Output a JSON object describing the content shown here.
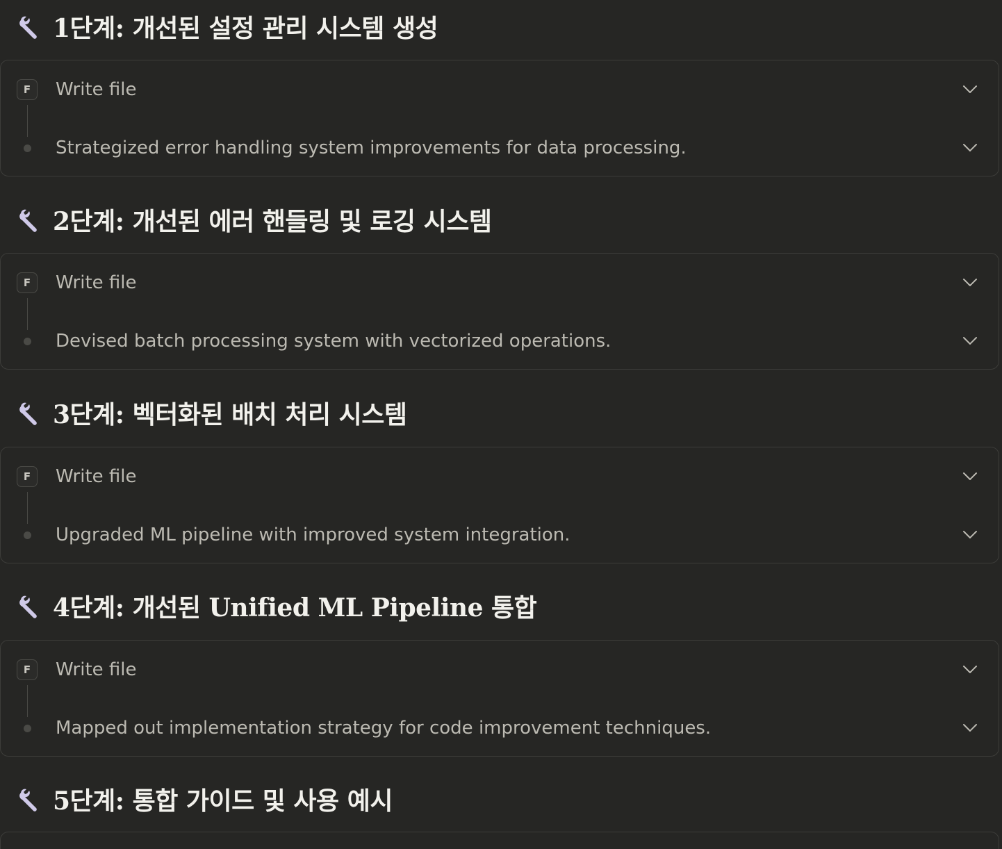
{
  "steps": [
    {
      "title": "1단계: 개선된 설정 관리 시스템 생성",
      "action_badge": "F",
      "action_label": "Write file",
      "summary": "Strategized error handling system improvements for data processing."
    },
    {
      "title": "2단계: 개선된 에러 핸들링 및 로깅 시스템",
      "action_badge": "F",
      "action_label": "Write file",
      "summary": "Devised batch processing system with vectorized operations."
    },
    {
      "title": "3단계: 벡터화된 배치 처리 시스템",
      "action_badge": "F",
      "action_label": "Write file",
      "summary": "Upgraded ML pipeline with improved system integration."
    },
    {
      "title": "4단계: 개선된 Unified ML Pipeline 통합",
      "action_badge": "F",
      "action_label": "Write file",
      "summary": "Mapped out implementation strategy for code improvement techniques."
    },
    {
      "title": "5단계: 통합 가이드 및 사용 예시"
    }
  ],
  "icons": {
    "heading": "wrench-icon",
    "expand": "chevron-down-icon"
  },
  "colors": {
    "background": "#262624",
    "border": "#3d3d3a",
    "heading_text": "#f2f1ec",
    "muted_text": "#bcbab2",
    "wrench": "#cfc9e8"
  }
}
